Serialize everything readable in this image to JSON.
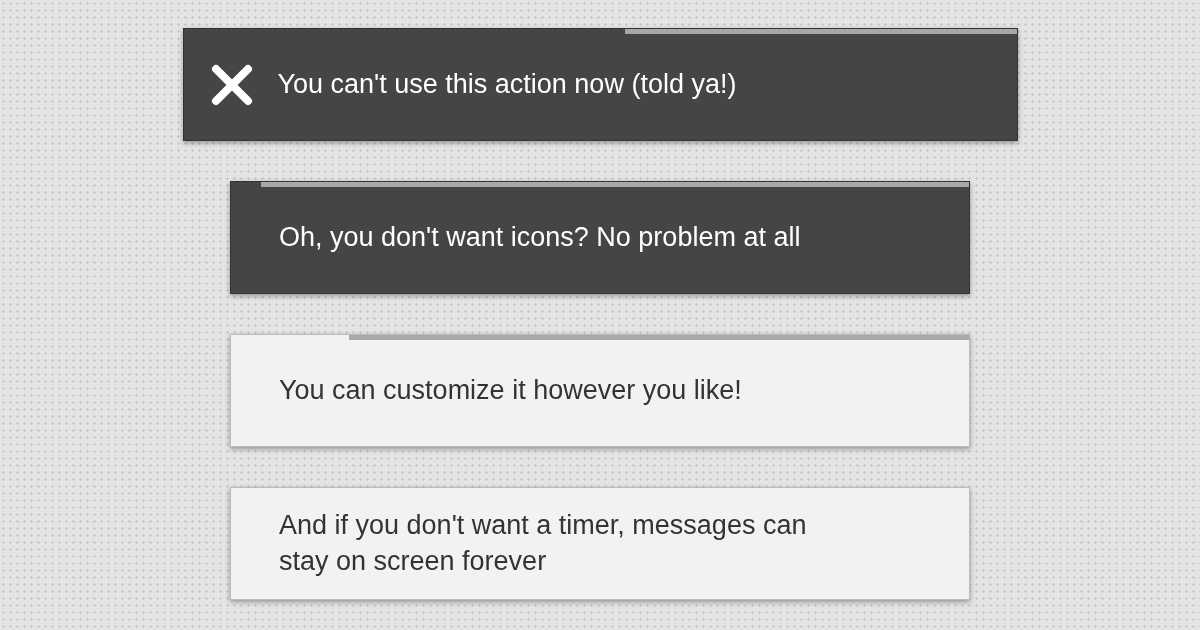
{
  "toasts": [
    {
      "dark": true,
      "icon": true,
      "message": "You can't use this action now (told ya!)",
      "timer": {
        "level": 0.47
      }
    },
    {
      "dark": true,
      "icon": false,
      "message": "Oh, you don't want icons? No problem at all",
      "timer": {
        "level": 0.96
      }
    },
    {
      "dark": false,
      "icon": false,
      "message": "You can customize it however you like!",
      "timer": {
        "level": 0.84
      }
    },
    {
      "dark": false,
      "icon": false,
      "message": "And if you don't want a timer, messages can stay on screen forever"
    }
  ]
}
